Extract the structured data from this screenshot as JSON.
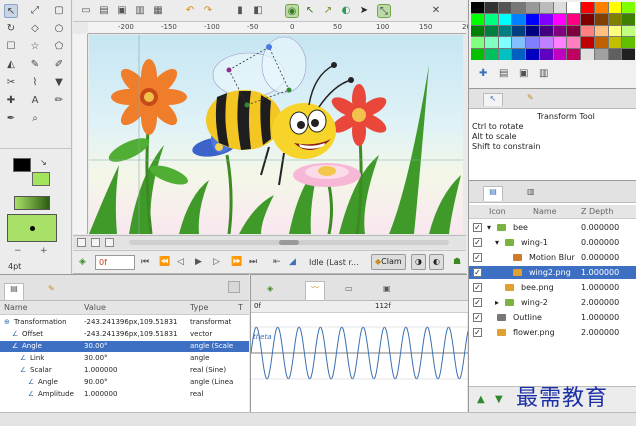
{
  "toolbox": {
    "size_label": "4pt",
    "icons": [
      "transform-icon",
      "smooth-move-icon",
      "scale-icon",
      "rotate-icon",
      "mirror-icon",
      "circle-icon",
      "rectangle-icon",
      "star-icon",
      "polygon-icon",
      "gradient-icon",
      "spline-icon",
      "draw-icon",
      "cutout-icon",
      "width-icon",
      "fill-icon",
      "eyedropper-icon",
      "text-icon",
      "sketch-icon",
      "brush-icon",
      "zoom-icon"
    ]
  },
  "ruler": {
    "ticks": [
      "-200",
      "-150",
      "-100",
      "-50",
      "0",
      "50",
      "100",
      "150",
      "200"
    ]
  },
  "navigation": {
    "frame_value": "0f",
    "status": "Idle (Last r...",
    "clamp_label": "Clam"
  },
  "tool_options": {
    "title": "Transform Tool",
    "lines": [
      "Ctrl to rotate",
      "Alt to scale",
      "Shift to constrain"
    ]
  },
  "layers": {
    "headers": {
      "icon": "Icon",
      "name": "Name",
      "z": "Z Depth"
    },
    "rows": [
      {
        "name": "bee",
        "z": "0.000000",
        "indent": 0,
        "expanded": true,
        "icon": "folder",
        "selected": false
      },
      {
        "name": "wing-1",
        "z": "0.000000",
        "indent": 1,
        "expanded": true,
        "icon": "folder",
        "selected": false
      },
      {
        "name": "Motion Blur",
        "z": "0.000000",
        "indent": 2,
        "expanded": false,
        "icon": "blur",
        "selected": false
      },
      {
        "name": "wing2.png",
        "z": "1.000000",
        "indent": 2,
        "expanded": false,
        "icon": "image",
        "selected": true
      },
      {
        "name": "bee.png",
        "z": "1.000000",
        "indent": 1,
        "expanded": false,
        "icon": "image",
        "selected": false
      },
      {
        "name": "wing-2",
        "z": "2.000000",
        "indent": 1,
        "expanded": false,
        "icon": "folder",
        "selected": false
      },
      {
        "name": "Outline",
        "z": "1.000000",
        "indent": 0,
        "expanded": false,
        "icon": "outline",
        "selected": false
      },
      {
        "name": "flower.png",
        "z": "2.000000",
        "indent": 0,
        "expanded": false,
        "icon": "image",
        "selected": false
      }
    ]
  },
  "params": {
    "headers": {
      "name": "Name",
      "value": "Value",
      "type": "Type",
      "t": "T"
    },
    "rows": [
      {
        "name": "Transformation",
        "value": "-243.241396px,109.51831",
        "type": "transformat",
        "indent": 0,
        "selected": false
      },
      {
        "name": "Offset",
        "value": "-243.241396px,109.51831",
        "type": "vector",
        "indent": 1,
        "selected": false
      },
      {
        "name": "Angle",
        "value": "30.00°",
        "type": "angle (Scale",
        "indent": 1,
        "selected": true
      },
      {
        "name": "Link",
        "value": "30.00°",
        "type": "angle",
        "indent": 2,
        "selected": false
      },
      {
        "name": "Scalar",
        "value": "1.000000",
        "type": "real (Sine)",
        "indent": 2,
        "selected": false
      },
      {
        "name": "Angle",
        "value": "90.00°",
        "type": "angle (Linea",
        "indent": 3,
        "selected": false
      },
      {
        "name": "Amplitude",
        "value": "1.000000",
        "type": "real",
        "indent": 3,
        "selected": false
      }
    ]
  },
  "graph": {
    "ruler_start": "0f",
    "ruler_mid": "112f",
    "label": "theta"
  },
  "watermark": "最需教育",
  "colors": {
    "accent_selection": "#3d6fc2",
    "palette": [
      "#000000",
      "#333333",
      "#555555",
      "#777777",
      "#999999",
      "#bbbbbb",
      "#dddddd",
      "#ffffff",
      "#ff0000",
      "#ff8000",
      "#ffff00",
      "#80ff00",
      "#00ff00",
      "#00ff80",
      "#00ffff",
      "#0080ff",
      "#0000ff",
      "#8000ff",
      "#ff00ff",
      "#ff0080",
      "#800000",
      "#804000",
      "#808000",
      "#408000",
      "#008000",
      "#008040",
      "#008080",
      "#004080",
      "#000080",
      "#400080",
      "#800080",
      "#800040",
      "#ff8080",
      "#ffc080",
      "#ffff80",
      "#c0ff80",
      "#80ff80",
      "#80ffc0",
      "#80ffff",
      "#80c0ff",
      "#8080ff",
      "#c080ff",
      "#ff80ff",
      "#ff80c0",
      "#c00000",
      "#c06000",
      "#c0c000",
      "#60c000",
      "#00c000",
      "#00c060",
      "#00c0c0",
      "#0060c0",
      "#0000c0",
      "#6000c0",
      "#c000c0",
      "#c00060",
      "#e0e0e0",
      "#a0a0a0",
      "#606060",
      "#202020"
    ]
  }
}
